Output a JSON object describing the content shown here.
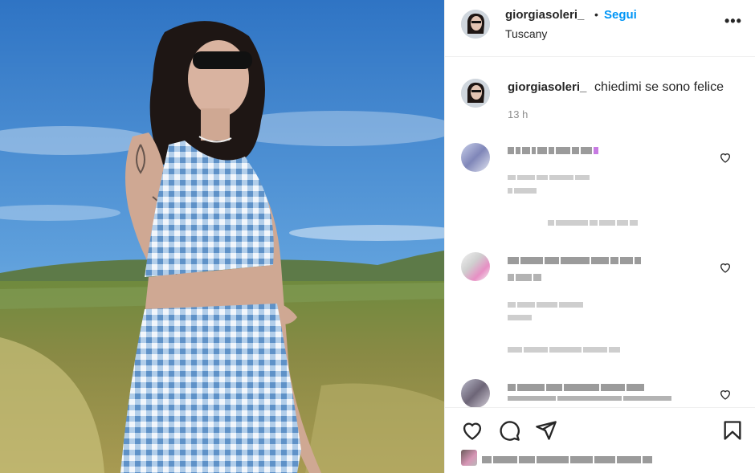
{
  "post": {
    "username": "giorgiasoleri_",
    "dot": "•",
    "follow_label": "Segui",
    "location": "Tuscany",
    "more_icon": "more-icon",
    "more_label": "•••"
  },
  "caption": {
    "username": "giorgiasoleri_",
    "text": "chiedimi se sono felice",
    "time": "13 h"
  },
  "actions": {
    "icons": [
      "heart-icon",
      "comment-icon",
      "share-icon",
      "save-icon"
    ]
  },
  "colors": {
    "follow": "#0095f6",
    "text": "#262626",
    "muted": "#8e8e8e",
    "divider": "#efefef"
  }
}
